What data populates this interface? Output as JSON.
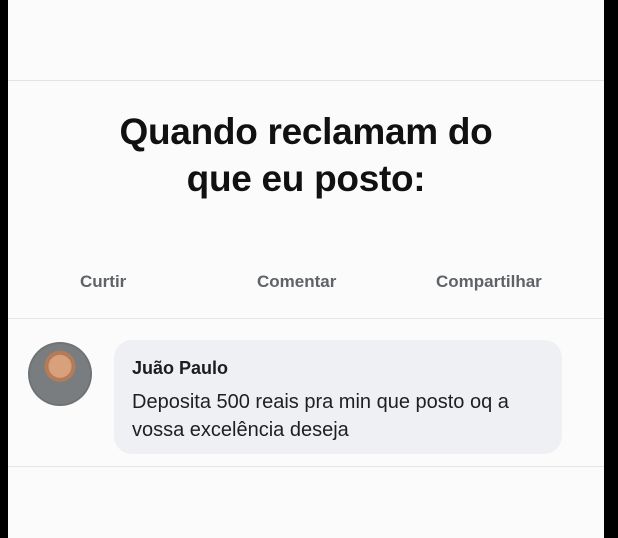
{
  "meme": {
    "caption_line_1": "Quando reclamam do",
    "caption_line_2": "que eu posto:"
  },
  "actions": {
    "like": "Curtir",
    "comment": "Comentar",
    "share": "Compartilhar"
  },
  "comment": {
    "author": "Juão Paulo",
    "text": "Deposita 500 reais pra min que posto oq a vossa excelência deseja",
    "avatar_icon": "profile-photo"
  }
}
